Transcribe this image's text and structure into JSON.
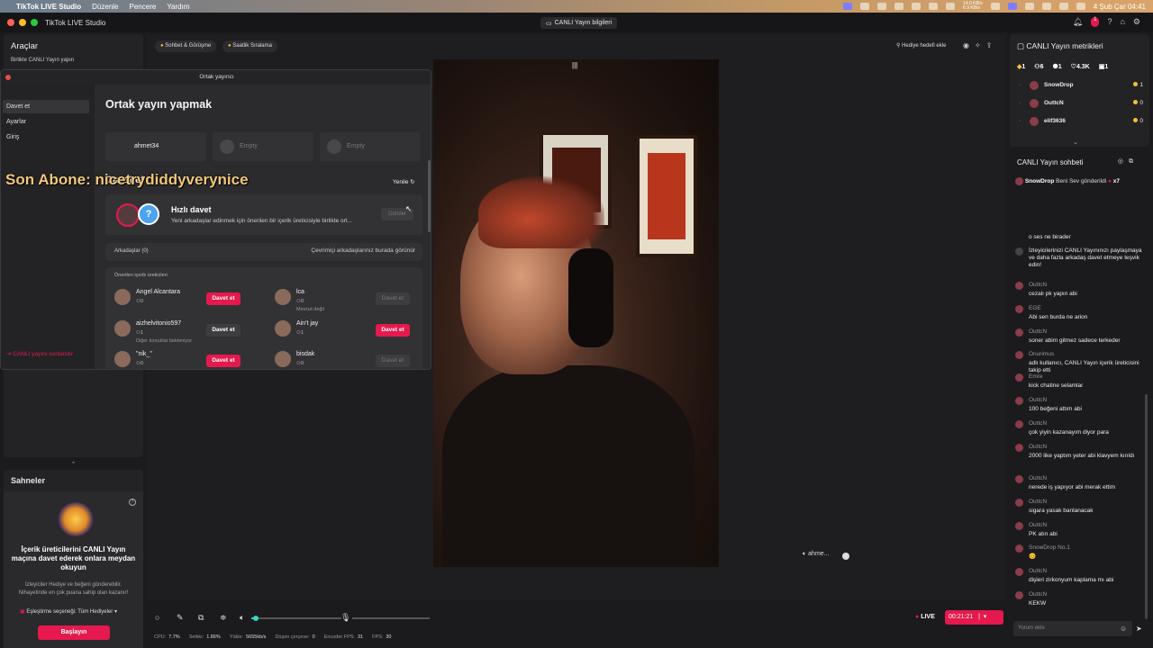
{
  "menubar": {
    "app": "TikTok LIVE Studio",
    "items": [
      "Düzenle",
      "Pencere",
      "Yardım"
    ],
    "net_up": "14.0 KB/s",
    "net_down": "6.9 KB/s",
    "clock": "4 Şub Çar  04:41"
  },
  "titlebar": {
    "title": "TikTok LIVE Studio",
    "live_info": "CANLI Yayın bilgileri",
    "notif_count": "1"
  },
  "left": {
    "tools_title": "Araçlar",
    "tools_sub": "Birlikte CANLI Yayın yapın",
    "scenes_title": "Sahneler",
    "scene_card": {
      "title": "İçerik üreticilerini CANLI Yayın maçına davet ederek onlara meydan okuyun",
      "desc": "İzleyiciler Hediye ve beğeni gönderebilir. Nihayetinde en çok puana sahip olan kazanır!",
      "match": "Eşleştirme seçeneği: Tüm Hediyeler",
      "start": "Başlayın"
    }
  },
  "center": {
    "chips": [
      "Sohbet & Görüşme",
      "Saatlik Sıralama"
    ],
    "gift_goal": "Hediye hedefi ekle",
    "stream_name": "ahme..."
  },
  "overlay": "Son Abone: nicetrydiddyverynice",
  "modal": {
    "header": "Ortak yayıncı",
    "side": [
      "Davet et",
      "Ayarlar",
      "Giriş"
    ],
    "end_live": "CANLI yayını sonlandır",
    "title": "Ortak yayın yapmak",
    "slots": [
      "ahmet34",
      "Empty",
      "Empty"
    ],
    "invite_title": "Davet et",
    "refresh": "Yenile",
    "quick": {
      "title": "Hızlı davet",
      "desc": "Yeni arkadaşlar edinmek için önerilen bir içerik üreticisiyle birlikte ort...",
      "send": "Gönder"
    },
    "friends": {
      "label": "Arkadaşlar (0)",
      "hint": "Çevrimiçi arkadaşlarınız burada görünür"
    },
    "suggested_title": "Önerilen içerik üreticileri",
    "candidates": [
      {
        "name": "Angel Alcantara",
        "count": "0",
        "status": "",
        "button": "Davet et",
        "style": "pink"
      },
      {
        "name": "lca",
        "count": "0",
        "status": "Mevcut değil",
        "button": "Davet et",
        "style": "off"
      },
      {
        "name": "aizhelvitonio597",
        "count": "1",
        "status": "Diğer konuklar bekleniyor",
        "button": "Davet et",
        "style": "dark"
      },
      {
        "name": "Ain't jay",
        "count": "1",
        "status": "",
        "button": "Davet et",
        "style": "pink"
      },
      {
        "name": "\"nik_\"",
        "count": "0",
        "status": "",
        "button": "Davet et",
        "style": "pink"
      },
      {
        "name": "bisdak",
        "count": "0",
        "status": "Diğer konuklar bekleniyor",
        "button": "Davet et",
        "style": "off"
      }
    ]
  },
  "controls": {
    "live_label": "LIVE",
    "timer": "00:21:21",
    "volume_level": 0.04,
    "stats": [
      {
        "k": "CPU:",
        "v": "7.7%"
      },
      {
        "k": "Selkkı:",
        "v": "1.86%"
      },
      {
        "k": "Yükle:",
        "v": "5655kb/s"
      },
      {
        "k": "Düşen çerçeve:",
        "v": "0"
      },
      {
        "k": "Encoder FPS:",
        "v": "31"
      },
      {
        "k": "FPS:",
        "v": "30"
      }
    ]
  },
  "metrics": {
    "title": "CANLI Yayın metrikleri",
    "stats": [
      "1",
      "6",
      "1",
      "4.3K",
      "1"
    ],
    "rows": [
      {
        "name": "SnowDrop",
        "count": "1"
      },
      {
        "name": "OuttcN",
        "count": "0"
      },
      {
        "name": "elif3636",
        "count": "0"
      }
    ]
  },
  "chat": {
    "title": "CANLI Yayın sohbeti",
    "gift": {
      "user": "SnowDrop",
      "text": "Beni Sev gönderildi",
      "mult": "x7"
    },
    "messages": [
      {
        "user": "",
        "text": "o ses ne birader",
        "sys": true
      },
      {
        "user": "",
        "text": "İzleyicilerinizi CANLI Yayınınızı paylaşmaya ve daha fazla arkadaş davet etmeye teşvik edin!",
        "sys": true
      },
      {
        "user": "OuttcN",
        "text": "cezalı pk yapın abi"
      },
      {
        "user": "EGE",
        "text": "Abi sen burda ne arion"
      },
      {
        "user": "OuttcN",
        "text": "soner abim gitmez sadece terkeder"
      },
      {
        "user": "Onurimus",
        "text": "adlı kullanıcı, CANLI Yayın içerik üreticisini takip etti"
      },
      {
        "user": "Emre",
        "text": "kick chatine selamlar"
      },
      {
        "user": "OuttcN",
        "text": "100 beğeni attım abi"
      },
      {
        "user": "OuttcN",
        "text": "çok yiyin kazanayım diyor para"
      },
      {
        "user": "OuttcN",
        "text": "2000 like yaptım yeter abi klavyem kırıldı"
      },
      {
        "user": "OuttcN",
        "text": "nerede iş yapıyor abi merak ettim"
      },
      {
        "user": "OuttcN",
        "text": "sigara yasak banlanacak"
      },
      {
        "user": "OuttcN",
        "text": "PK atın abi"
      },
      {
        "user": "SnowDrop  No.1",
        "text": "😊"
      },
      {
        "user": "OuttcN",
        "text": "dişleri zirkonyum kaplama mı abi"
      },
      {
        "user": "OuttcN",
        "text": "KEKW"
      }
    ],
    "input_placeholder": "Yorum ekle"
  }
}
